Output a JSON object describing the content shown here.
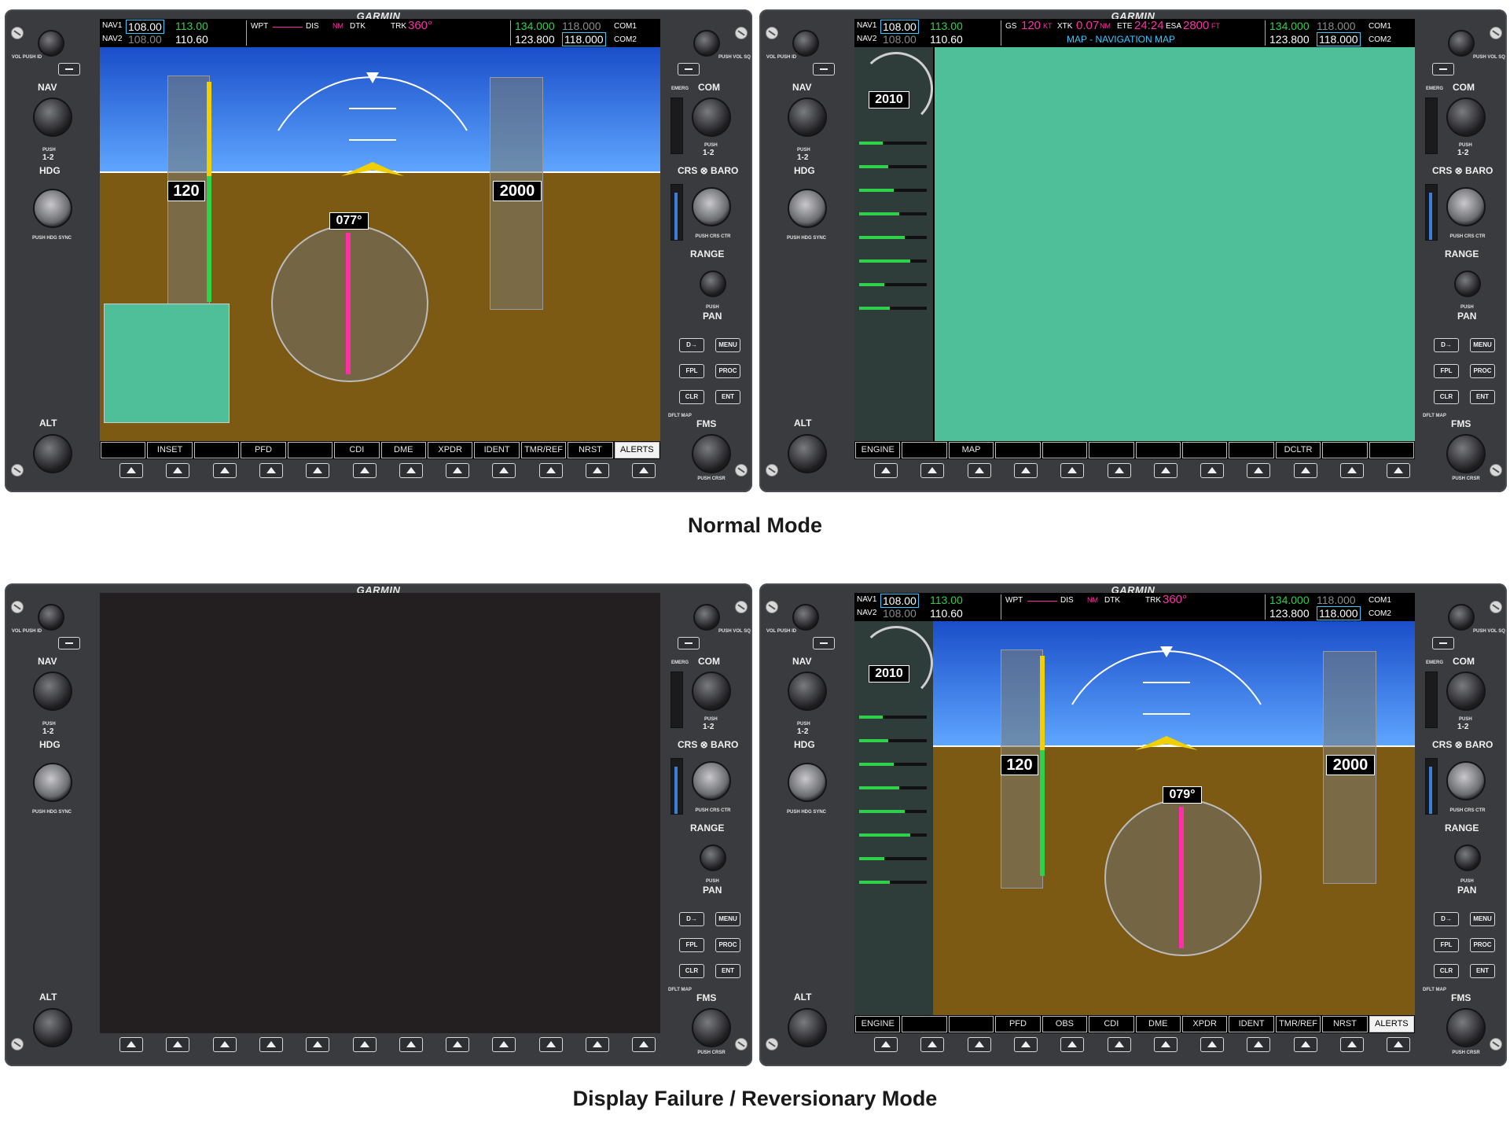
{
  "brand": "GARMIN",
  "captions": {
    "normal": "Normal Mode",
    "failure": "Display Failure / Reversionary Mode"
  },
  "bezel": {
    "left": {
      "vol_push_id": "VOL PUSH ID",
      "nav": "NAV",
      "push_12": "PUSH",
      "one_two": "1-2",
      "hdg": "HDG",
      "push_hdg_sync": "PUSH HDG SYNC",
      "alt": "ALT"
    },
    "right": {
      "vol_push_sq": "PUSH VOL SQ",
      "emerg": "EMERG",
      "com": "COM",
      "push_12": "PUSH",
      "one_two": "1-2",
      "crs_baro": "CRS ⊗ BARO",
      "push_crs_ctr": "PUSH CRS CTR",
      "range": "RANGE",
      "push": "PUSH",
      "pan": "PAN",
      "direct": "D→",
      "menu": "MENU",
      "fpl": "FPL",
      "proc": "PROC",
      "clr": "CLR",
      "ent": "ENT",
      "dflt_map": "DFLT MAP",
      "fms": "FMS",
      "push_crsr": "PUSH CRSR"
    }
  },
  "pfd_top": {
    "nav1_label": "NAV1",
    "nav1_active": "108.00",
    "nav1_standby": "113.00",
    "nav2_label": "NAV2",
    "nav2_active": "108.00",
    "nav2_standby": "110.60",
    "wpt": "WPT",
    "dis": "DIS",
    "nm": "NM",
    "dtk": "DTK",
    "trk": "TRK",
    "trk_value": "360°",
    "com1_active": "134.000",
    "com1_standby": "118.000",
    "com1_label": "COM1",
    "com2_active": "123.800",
    "com2_standby": "118.000",
    "com2_label": "COM2"
  },
  "mfd_top": {
    "gs": "GS",
    "gs_value": "120",
    "gs_unit": "KT",
    "xtk": "XTK",
    "xtk_value": "0.07",
    "xtk_unit": "NM",
    "ete": "ETE",
    "ete_value": "24:24",
    "esa": "ESA",
    "esa_value": "2800",
    "esa_unit": "FT",
    "page_title": "MAP - NAVIGATION MAP"
  },
  "pfd_instruments": {
    "airspeed": "120",
    "altitude": "2000",
    "heading": "077°",
    "heading_reversionary": "079°",
    "rpm": "2010"
  },
  "softkeys": {
    "pfd": [
      "",
      "INSET",
      "",
      "PFD",
      "",
      "CDI",
      "DME",
      "XPDR",
      "IDENT",
      "TMR/REF",
      "NRST",
      "ALERTS"
    ],
    "mfd": [
      "ENGINE",
      "",
      "MAP",
      "",
      "",
      "",
      "",
      "",
      "",
      "DCLTR",
      "",
      ""
    ],
    "reversionary": [
      "ENGINE",
      "",
      "",
      "PFD",
      "OBS",
      "CDI",
      "DME",
      "XPDR",
      "IDENT",
      "TMR/REF",
      "NRST",
      "ALERTS"
    ]
  },
  "colors": {
    "bezel": "#3a3b3f",
    "sky": "#1a4ec9",
    "ground": "#7d5a14",
    "magenta": "#ff2fa8",
    "green": "#2fd04a",
    "cyan": "#39c9ff"
  }
}
